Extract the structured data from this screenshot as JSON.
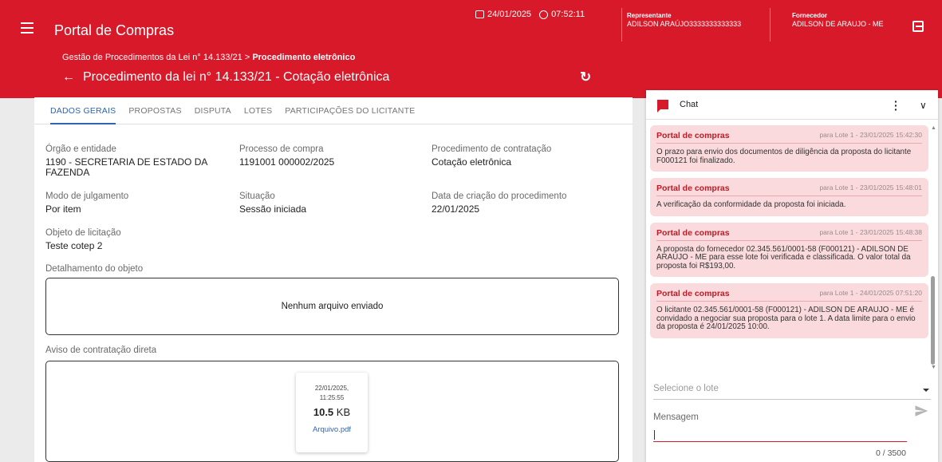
{
  "header": {
    "app_title": "Portal de Compras",
    "date": "24/01/2025",
    "time": "07:52:11",
    "representative_label": "Representante",
    "representative_name": "ADILSON ARAÚJO3333333333333",
    "supplier_label": "Fornecedor",
    "supplier_name": "ADILSON DE ARAUJO - ME",
    "breadcrumb_prefix": "Gestão de Procedimentos da Lei n° 14.133/21 > ",
    "breadcrumb_current": "Procedimento eletrônico",
    "page_title": "Procedimento da lei n° 14.133/21 - Cotação eletrônica",
    "brand_color": "#d7192a"
  },
  "tabs": [
    "DADOS GERAIS",
    "PROPOSTAS",
    "DISPUTA",
    "LOTES",
    "PARTICIPAÇÕES DO LICITANTE"
  ],
  "fields": {
    "orgao_label": "Órgão e entidade",
    "orgao_value": "1190 - SECRETARIA DE ESTADO DA FAZENDA",
    "processo_label": "Processo de compra",
    "processo_value": "1191001 000002/2025",
    "procedimento_label": "Procedimento de contratação",
    "procedimento_value": "Cotação eletrônica",
    "modo_label": "Modo de julgamento",
    "modo_value": "Por item",
    "situacao_label": "Situação",
    "situacao_value": "Sessão iniciada",
    "data_label": "Data de criação do procedimento",
    "data_value": "22/01/2025",
    "objeto_label": "Objeto de licitação",
    "objeto_value": "Teste cotep 2",
    "detalhamento_label": "Detalhamento do objeto",
    "detalhamento_empty": "Nenhum arquivo enviado",
    "aviso_label": "Aviso de contratação direta"
  },
  "file": {
    "date": "22/01/2025,",
    "time": "11:25:55",
    "size_value": "10.5",
    "size_unit": "KB",
    "name": "Arquivo.pdf"
  },
  "chat": {
    "title": "Chat",
    "messages": [
      {
        "author": "Portal de compras",
        "meta": "para Lote 1  -  23/01/2025 15:42:30",
        "text": "O prazo para envio dos documentos de diligência da proposta do licitante F000121 foi finalizado."
      },
      {
        "author": "Portal de compras",
        "meta": "para Lote 1  -  23/01/2025 15:48:01",
        "text": "A verificação da conformidade da proposta foi iniciada."
      },
      {
        "author": "Portal de compras",
        "meta": "para Lote 1  -  23/01/2025 15:48:38",
        "text": "A proposta do fornecedor 02.345.561/0001-58 (F000121) - ADILSON DE ARAUJO - ME para esse lote foi verificada e classificada. O valor total da proposta foi R$193,00."
      },
      {
        "author": "Portal de compras",
        "meta": "para Lote 1  -  24/01/2025 07:51:20",
        "text": "O licitante 02.345.561/0001-58 (F000121) - ADILSON DE ARAUJO - ME é convidado a negociar sua proposta para o lote  1. A data limite para o envio da proposta é 24/01/2025 10:00."
      }
    ],
    "select_placeholder": "Selecione o lote",
    "message_label": "Mensagem",
    "counter": "0 / 3500"
  }
}
